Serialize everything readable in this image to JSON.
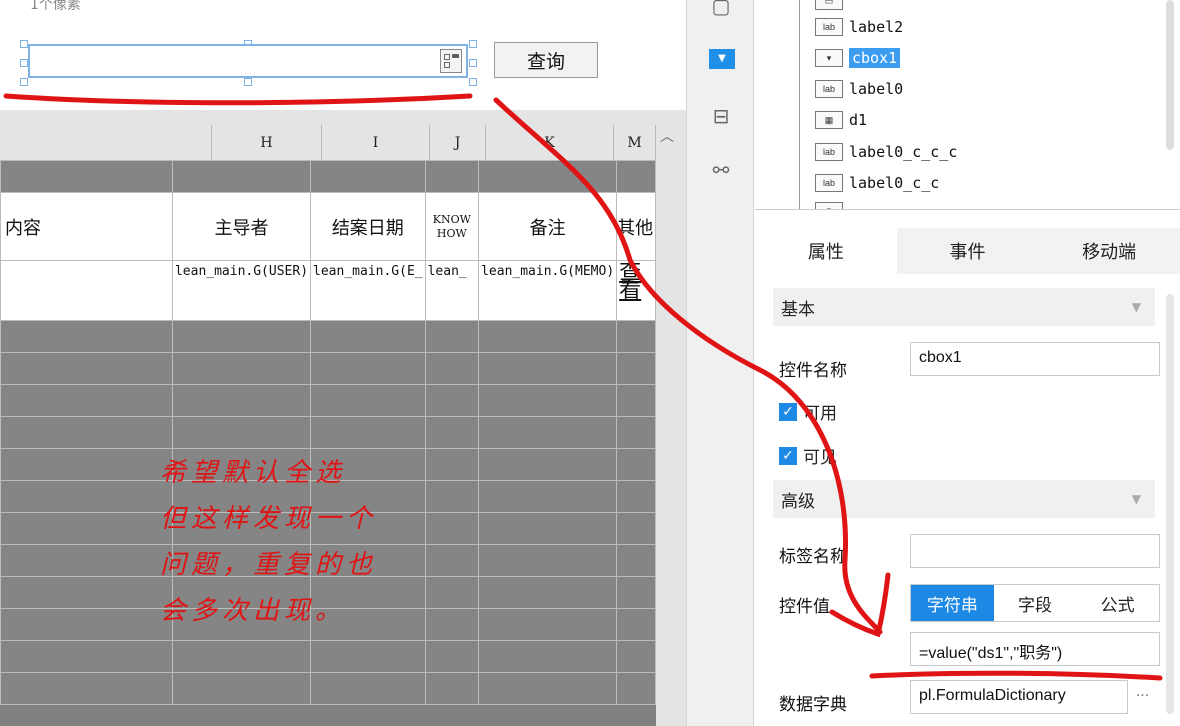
{
  "canvas": {
    "top_label": "1个像素",
    "query_button": "查询"
  },
  "sheet": {
    "columns": [
      "H",
      "I",
      "J",
      "K",
      "M"
    ],
    "headers": [
      "内容",
      "主导者",
      "结案日期",
      "KNOW HOW",
      "备注",
      "其他"
    ],
    "fields": [
      "",
      "lean_main.G(USER)",
      "lean_main.G(E_",
      "lean_",
      "lean_main.G(MEMO)",
      "查看"
    ]
  },
  "annotation": {
    "lines": [
      "希望默认全选",
      "但这样发现一个",
      "问题，重复的也",
      "会多次出现。"
    ]
  },
  "tree": {
    "items": [
      {
        "label": "label2",
        "icon": "lab"
      },
      {
        "label": "cbox1",
        "icon": "combo",
        "selected": true
      },
      {
        "label": "label0",
        "icon": "lab"
      },
      {
        "label": "d1",
        "icon": "date"
      },
      {
        "label": "label0_c_c_c",
        "icon": "lab"
      },
      {
        "label": "label0_c_c",
        "icon": "lab"
      }
    ]
  },
  "tabs": [
    "属性",
    "事件",
    "移动端"
  ],
  "props": {
    "basic_title": "基本",
    "name_label": "控件名称",
    "name_value": "cbox1",
    "enabled_label": "可用",
    "visible_label": "可见",
    "advanced_title": "高级",
    "tag_label": "标签名称",
    "tag_value": "",
    "value_label": "控件值",
    "value_modes": [
      "字符串",
      "字段",
      "公式"
    ],
    "value_formula": "=value(\"ds1\",\"职务\")",
    "dict_label": "数据字典",
    "dict_value": "pl.FormulaDictionary",
    "more_label": "···"
  },
  "colors": {
    "accent": "#1e88e5",
    "selection": "#3c9cf0",
    "annotation": "#e01414"
  }
}
